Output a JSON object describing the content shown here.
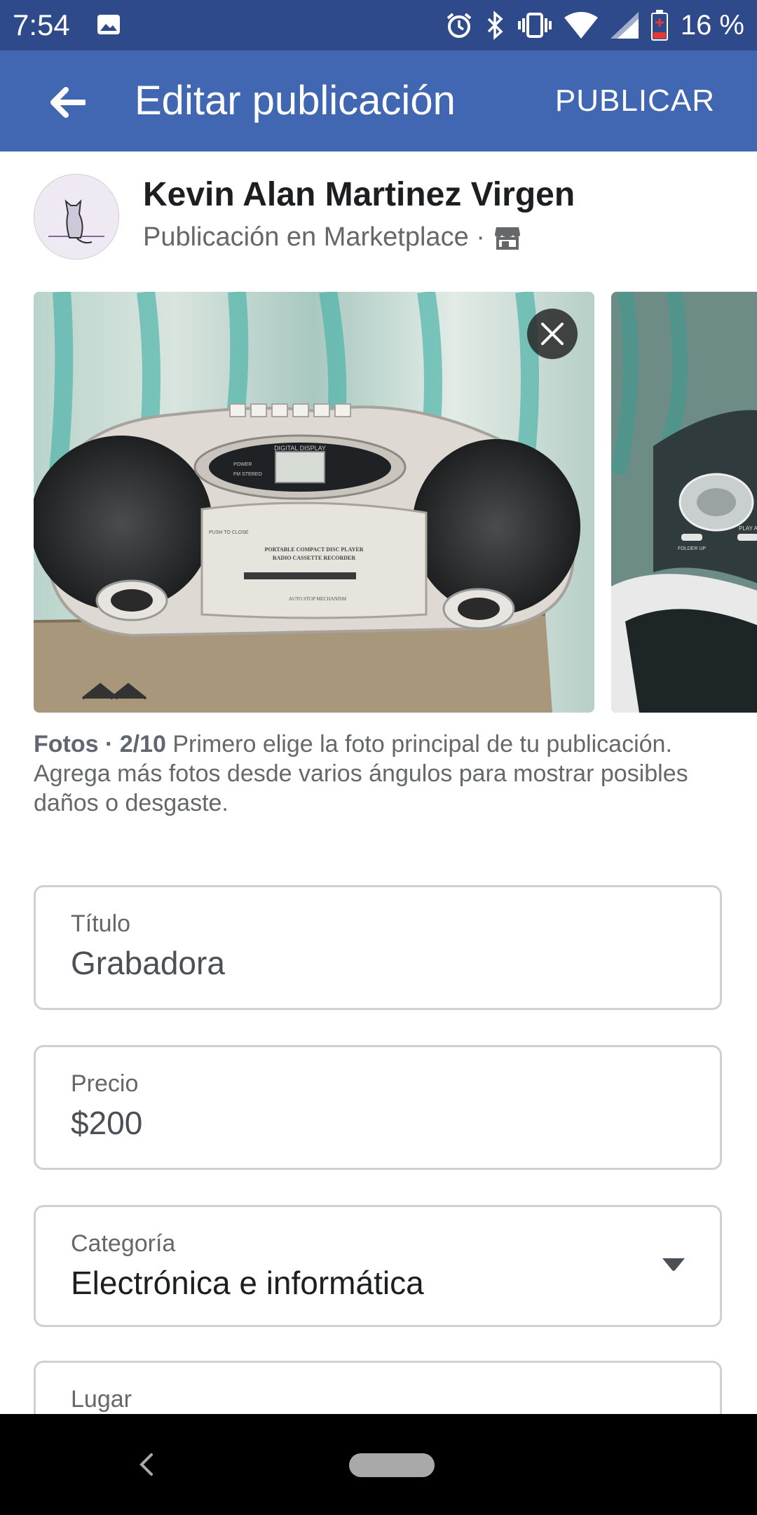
{
  "status_bar": {
    "time": "7:54",
    "battery": "16 %"
  },
  "app_bar": {
    "title": "Editar publicación",
    "publish_label": "PUBLICAR",
    "accent": "#4267b2"
  },
  "author": {
    "name": "Kevin Alan Martinez Virgen",
    "subtitle": "Publicación en Marketplace ·"
  },
  "photos": {
    "caption_prefix": "Fotos · 2/10",
    "caption_text": " Primero elige la foto principal de tu publicación. Agrega más fotos desde varios ángulos para mostrar posibles daños o desgaste.",
    "overlay_text": {
      "display": "DIGITAL DISPLAY",
      "power": "POWER",
      "fm": "FM STEREO",
      "push": "PUSH TO CLOSE",
      "player_line1": "PORTABLE COMPACT DISC PLAYER",
      "player_line2": "RADIO CASSETTE RECORDER",
      "auto": "AUTO STOP MECHANISM",
      "play": "PLAY A",
      "folder": "FOLDER UP"
    }
  },
  "fields": {
    "title": {
      "label": "Título",
      "value": "Grabadora"
    },
    "price": {
      "label": "Precio",
      "value": "$200"
    },
    "category": {
      "label": "Categoría",
      "value": "Electrónica e informática"
    },
    "location": {
      "label": "Lugar"
    }
  }
}
